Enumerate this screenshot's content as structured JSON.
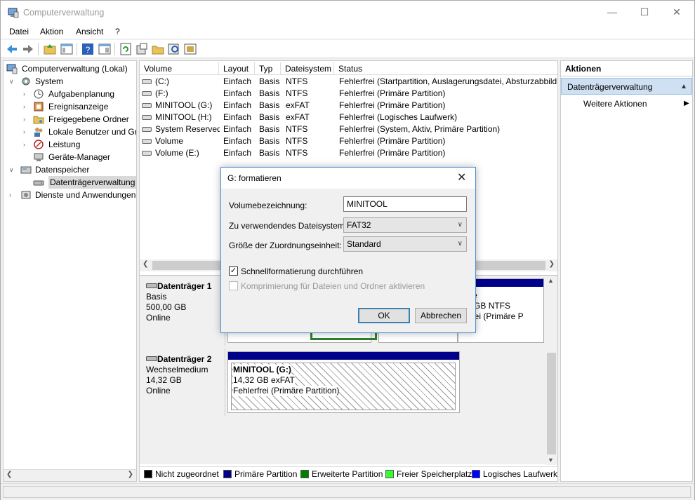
{
  "window": {
    "title": "Computerverwaltung"
  },
  "menu": [
    "Datei",
    "Aktion",
    "Ansicht",
    "?"
  ],
  "tree": {
    "root": "Computerverwaltung (Lokal)",
    "system": "System",
    "aufgabenplanung": "Aufgabenplanung",
    "ereignisanzeige": "Ereignisanzeige",
    "freigegebene_ordner": "Freigegebene Ordner",
    "lokale_benutzer": "Lokale Benutzer und Gru",
    "leistung": "Leistung",
    "geraete_manager": "Geräte-Manager",
    "datenspeicher": "Datenspeicher",
    "datentraegerverwaltung": "Datenträgerverwaltung",
    "dienste": "Dienste und Anwendungen"
  },
  "volume_table": {
    "headers": [
      "Volume",
      "Layout",
      "Typ",
      "Dateisystem",
      "Status"
    ],
    "rows": [
      [
        "(C:)",
        "Einfach",
        "Basis",
        "NTFS",
        "Fehlerfrei (Startpartition, Auslagerungsdatei, Absturzabbild,"
      ],
      [
        "(F:)",
        "Einfach",
        "Basis",
        "NTFS",
        "Fehlerfrei (Primäre Partition)"
      ],
      [
        "MINITOOL (G:)",
        "Einfach",
        "Basis",
        "exFAT",
        "Fehlerfrei (Primäre Partition)"
      ],
      [
        "MINITOOL (H:)",
        "Einfach",
        "Basis",
        "exFAT",
        "Fehlerfrei (Logisches Laufwerk)"
      ],
      [
        "System Reserved",
        "Einfach",
        "Basis",
        "NTFS",
        "Fehlerfrei (System, Aktiv, Primäre Partition)"
      ],
      [
        "Volume",
        "Einfach",
        "Basis",
        "NTFS",
        "Fehlerfrei (Primäre Partition)"
      ],
      [
        "Volume (E:)",
        "Einfach",
        "Basis",
        "NTFS",
        "Fehlerfrei (Primäre Partition)"
      ]
    ]
  },
  "disk1": {
    "name": "Datenträger 1",
    "type": "Basis",
    "size": "500,00 GB",
    "state": "Online",
    "partition_right_name": "ume",
    "partition_right_size": ",31 GB NTFS",
    "partition_right_status": "lerfrei (Primäre P"
  },
  "disk2": {
    "name": "Datenträger 2",
    "type": "Wechselmedium",
    "size": "14,32 GB",
    "state": "Online",
    "partition_name": "MINITOOL  (G:)",
    "partition_size": "14,32 GB exFAT",
    "partition_status": "Fehlerfrei (Primäre Partition)"
  },
  "legend": [
    {
      "label": "Nicht zugeordnet",
      "color": "#000000"
    },
    {
      "label": "Primäre Partition",
      "color": "#00008b"
    },
    {
      "label": "Erweiterte Partition",
      "color": "#008000"
    },
    {
      "label": "Freier Speicherplatz",
      "color": "#33ff33"
    },
    {
      "label": "Logisches Laufwerk",
      "color": "#0000ff"
    }
  ],
  "actions": {
    "header": "Aktionen",
    "section": "Datenträgerverwaltung",
    "more": "Weitere Aktionen"
  },
  "dialog": {
    "title": "G: formatieren",
    "volume_label": "Volumebezeichnung:",
    "volume_value": "MINITOOL",
    "fs_label": "Zu verwendendes Dateisystem:",
    "fs_value": "FAT32",
    "alloc_label": "Größe der Zuordnungseinheit:",
    "alloc_value": "Standard",
    "quick_format": "Schnellformatierung durchführen",
    "quick_format_checked": true,
    "compression": "Komprimierung für Dateien und Ordner aktivieren",
    "ok": "OK",
    "cancel": "Abbrechen"
  }
}
